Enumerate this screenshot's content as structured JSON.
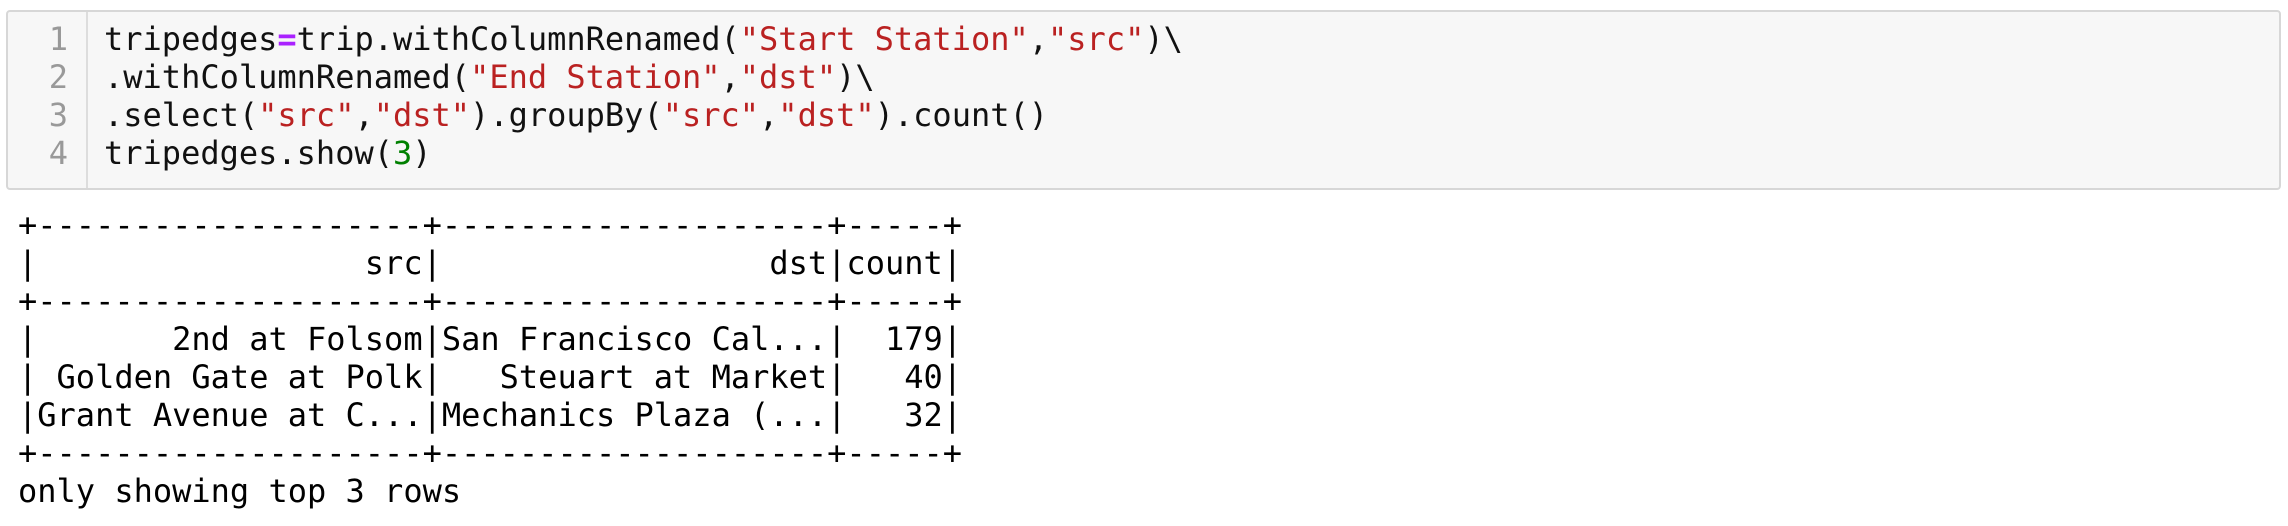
{
  "cell": {
    "line_numbers": [
      "1",
      "2",
      "3",
      "4"
    ],
    "code": [
      [
        {
          "t": "tripedges",
          "c": "plain"
        },
        {
          "t": "=",
          "c": "op"
        },
        {
          "t": "trip.withColumnRenamed(",
          "c": "plain"
        },
        {
          "t": "\"Start Station\"",
          "c": "str"
        },
        {
          "t": ",",
          "c": "plain"
        },
        {
          "t": "\"src\"",
          "c": "str"
        },
        {
          "t": ")\\",
          "c": "plain"
        }
      ],
      [
        {
          "t": ".withColumnRenamed(",
          "c": "plain"
        },
        {
          "t": "\"End Station\"",
          "c": "str"
        },
        {
          "t": ",",
          "c": "plain"
        },
        {
          "t": "\"dst\"",
          "c": "str"
        },
        {
          "t": ")\\",
          "c": "plain"
        }
      ],
      [
        {
          "t": ".select(",
          "c": "plain"
        },
        {
          "t": "\"src\"",
          "c": "str"
        },
        {
          "t": ",",
          "c": "plain"
        },
        {
          "t": "\"dst\"",
          "c": "str"
        },
        {
          "t": ").groupBy(",
          "c": "plain"
        },
        {
          "t": "\"src\"",
          "c": "str"
        },
        {
          "t": ",",
          "c": "plain"
        },
        {
          "t": "\"dst\"",
          "c": "str"
        },
        {
          "t": ").count()",
          "c": "plain"
        }
      ],
      [
        {
          "t": "tripedges.show(",
          "c": "plain"
        },
        {
          "t": "3",
          "c": "num"
        },
        {
          "t": ")",
          "c": "plain"
        }
      ]
    ]
  },
  "output": {
    "lines": [
      "+--------------------+--------------------+-----+",
      "|                 src|                 dst|count|",
      "+--------------------+--------------------+-----+",
      "|       2nd at Folsom|San Francisco Cal...|  179|",
      "| Golden Gate at Polk|   Steuart at Market|   40|",
      "|Grant Avenue at C...|Mechanics Plaza (...|   32|",
      "+--------------------+--------------------+-----+",
      "only showing top 3 rows"
    ]
  },
  "colors": {
    "string": "#ba2121",
    "operator": "#aa22ff",
    "number": "#008000",
    "line_number": "#999999",
    "cell_background": "#f7f7f7"
  }
}
